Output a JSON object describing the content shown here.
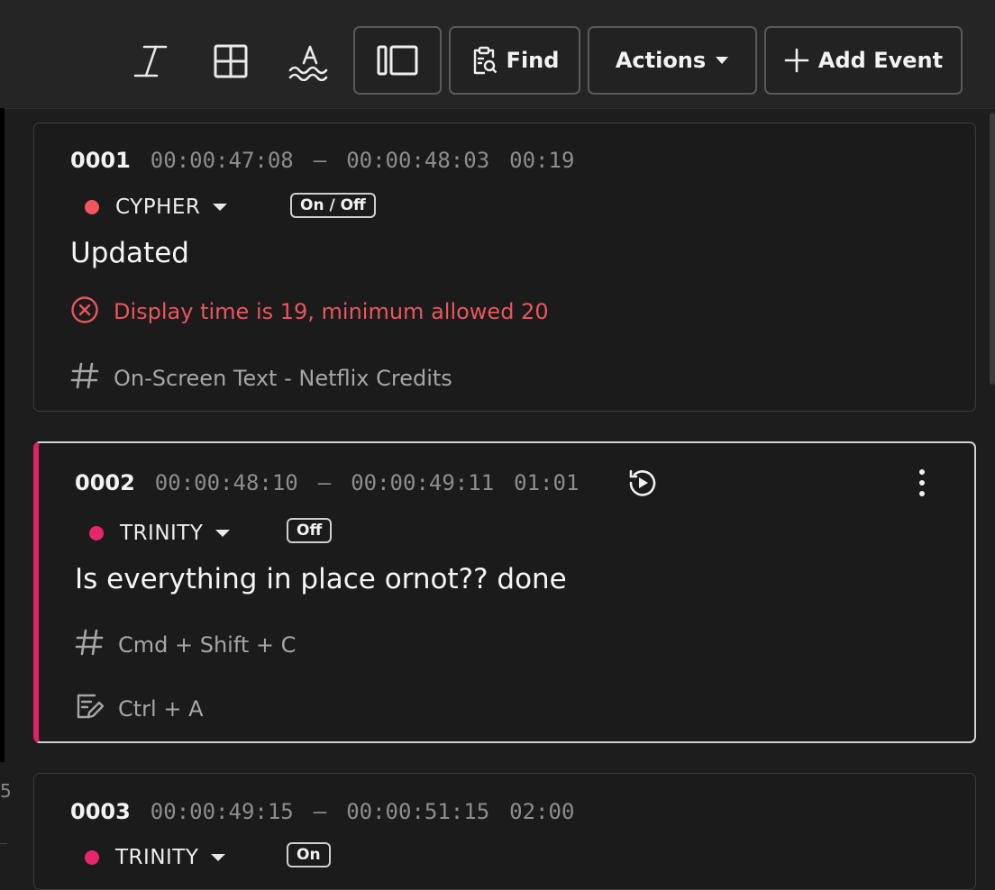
{
  "toolbar": {
    "icons": [
      "italic-icon",
      "grid-icon",
      "text-wave-icon"
    ],
    "find_label": "Find",
    "actions_label": "Actions",
    "add_event_label": "Add Event"
  },
  "events": [
    {
      "number": "0001",
      "start": "00:00:47:08",
      "separator": "–",
      "end": "00:00:48:03",
      "duration": "00:19",
      "speaker": "CYPHER",
      "speaker_color": "#f0565e",
      "badge": "On / Off",
      "caption": "Updated",
      "error": "Display time is 19, minimum allowed 20",
      "tag": "On-Screen Text - Netflix Credits"
    },
    {
      "number": "0002",
      "start": "00:00:48:10",
      "separator": "–",
      "end": "00:00:49:11",
      "duration": "01:01",
      "speaker": "TRINITY",
      "speaker_color": "#e8266e",
      "badge": "Off",
      "caption": "Is everything in place ornot?? done",
      "tag": "Cmd + Shift + C",
      "note": "Ctrl + A",
      "selected": true
    },
    {
      "number": "0003",
      "start": "00:00:49:15",
      "separator": "–",
      "end": "00:00:51:15",
      "duration": "02:00",
      "speaker": "TRINITY",
      "speaker_color": "#e8266e",
      "badge": "On"
    }
  ],
  "colors": {
    "background": "#1d1d1d",
    "accent_selected": "#e0206a",
    "error": "#e8565e"
  },
  "side": {
    "left_mark": "5"
  }
}
